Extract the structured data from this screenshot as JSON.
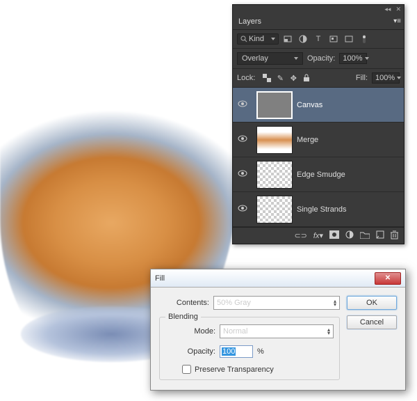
{
  "layers_panel": {
    "title": "Layers",
    "filter_label": "Kind",
    "blend_mode": "Overlay",
    "opacity_label": "Opacity:",
    "opacity_value": "100%",
    "lock_label": "Lock:",
    "fill_label": "Fill:",
    "fill_value": "100%",
    "layers": [
      {
        "name": "Canvas",
        "visible": true,
        "selected": true,
        "thumb": "canvas"
      },
      {
        "name": "Merge",
        "visible": true,
        "selected": false,
        "thumb": "merge"
      },
      {
        "name": "Edge Smudge",
        "visible": true,
        "selected": false,
        "thumb": "checker"
      },
      {
        "name": "Single Strands",
        "visible": true,
        "selected": false,
        "thumb": "checker"
      }
    ]
  },
  "fill_dialog": {
    "title": "Fill",
    "contents_label": "Contents:",
    "contents_value": "50% Gray",
    "blending_group": "Blending",
    "mode_label": "Mode:",
    "mode_value": "Normal",
    "opacity_label": "Opacity:",
    "opacity_value": "100",
    "opacity_suffix": "%",
    "preserve_label": "Preserve Transparency",
    "ok": "OK",
    "cancel": "Cancel"
  }
}
